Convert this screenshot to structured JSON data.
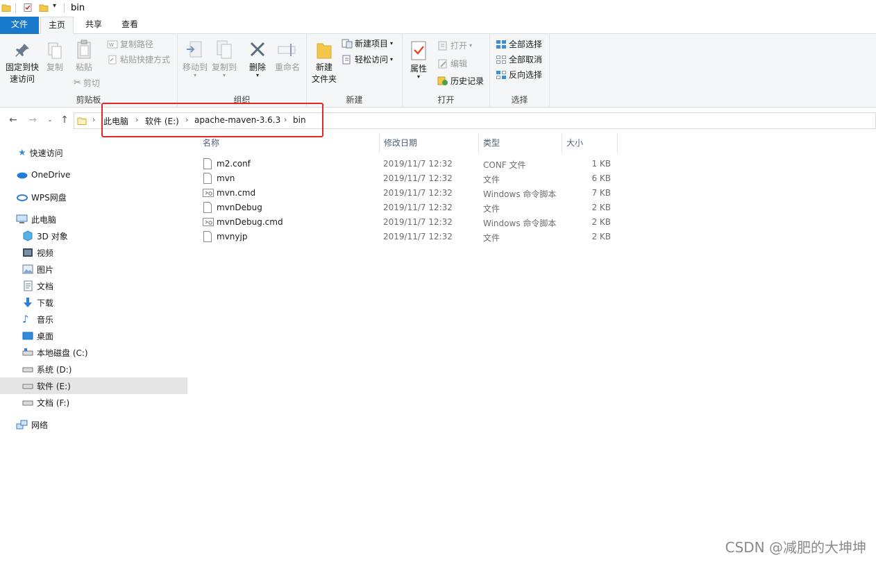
{
  "window": {
    "title": "bin"
  },
  "tabs": {
    "file": "文件",
    "home": "主页",
    "share": "共享",
    "view": "查看"
  },
  "ribbon": {
    "clipboard": {
      "label": "剪贴板",
      "pin_line1": "固定到快",
      "pin_line2": "速访问",
      "copy": "复制",
      "paste": "粘贴",
      "copy_path": "复制路径",
      "paste_shortcut": "粘贴快捷方式",
      "cut": "剪切"
    },
    "organize": {
      "label": "组织",
      "move_to": "移动到",
      "copy_to": "复制到",
      "delete": "删除",
      "rename": "重命名"
    },
    "new": {
      "label": "新建",
      "new_folder_line1": "新建",
      "new_folder_line2": "文件夹",
      "new_item": "新建项目",
      "easy_access": "轻松访问"
    },
    "open": {
      "label": "打开",
      "properties": "属性",
      "open": "打开",
      "edit": "编辑",
      "history": "历史记录"
    },
    "select": {
      "label": "选择",
      "select_all": "全部选择",
      "select_none": "全部取消",
      "invert": "反向选择"
    }
  },
  "address": {
    "crumbs": [
      "此电脑",
      "软件 (E:)",
      "apache-maven-3.6.3",
      "bin"
    ]
  },
  "sidebar": {
    "items": [
      {
        "label": "快速访问",
        "icon": "star-icon"
      },
      {
        "label": "OneDrive",
        "icon": "cloud-icon"
      },
      {
        "label": "WPS网盘",
        "icon": "cloud-icon"
      },
      {
        "label": "此电脑",
        "icon": "computer-icon"
      },
      {
        "label": "3D 对象",
        "icon": "cube-icon"
      },
      {
        "label": "视频",
        "icon": "video-icon"
      },
      {
        "label": "图片",
        "icon": "picture-icon"
      },
      {
        "label": "文档",
        "icon": "document-icon"
      },
      {
        "label": "下载",
        "icon": "download-icon"
      },
      {
        "label": "音乐",
        "icon": "music-icon"
      },
      {
        "label": "桌面",
        "icon": "desktop-icon"
      },
      {
        "label": "本地磁盘 (C:)",
        "icon": "drive-icon"
      },
      {
        "label": "系统 (D:)",
        "icon": "drive-icon"
      },
      {
        "label": "软件 (E:)",
        "icon": "drive-icon"
      },
      {
        "label": "文档 (F:)",
        "icon": "drive-icon"
      },
      {
        "label": "网络",
        "icon": "network-icon"
      }
    ]
  },
  "columns": {
    "name": "名称",
    "modified": "修改日期",
    "type": "类型",
    "size": "大小"
  },
  "files": [
    {
      "name": "m2.conf",
      "modified": "2019/11/7 12:32",
      "type": "CONF 文件",
      "size": "1 KB",
      "icon": "file-icon"
    },
    {
      "name": "mvn",
      "modified": "2019/11/7 12:32",
      "type": "文件",
      "size": "6 KB",
      "icon": "file-icon"
    },
    {
      "name": "mvn.cmd",
      "modified": "2019/11/7 12:32",
      "type": "Windows 命令脚本",
      "size": "7 KB",
      "icon": "script-icon"
    },
    {
      "name": "mvnDebug",
      "modified": "2019/11/7 12:32",
      "type": "文件",
      "size": "2 KB",
      "icon": "file-icon"
    },
    {
      "name": "mvnDebug.cmd",
      "modified": "2019/11/7 12:32",
      "type": "Windows 命令脚本",
      "size": "2 KB",
      "icon": "script-icon"
    },
    {
      "name": "mvnyjp",
      "modified": "2019/11/7 12:32",
      "type": "文件",
      "size": "2 KB",
      "icon": "file-icon"
    }
  ],
  "watermark": "CSDN @减肥的大坤坤",
  "colors": {
    "accent": "#1979ca",
    "highlight": "#e0282a",
    "selected_bg": "#e5e5e5"
  }
}
